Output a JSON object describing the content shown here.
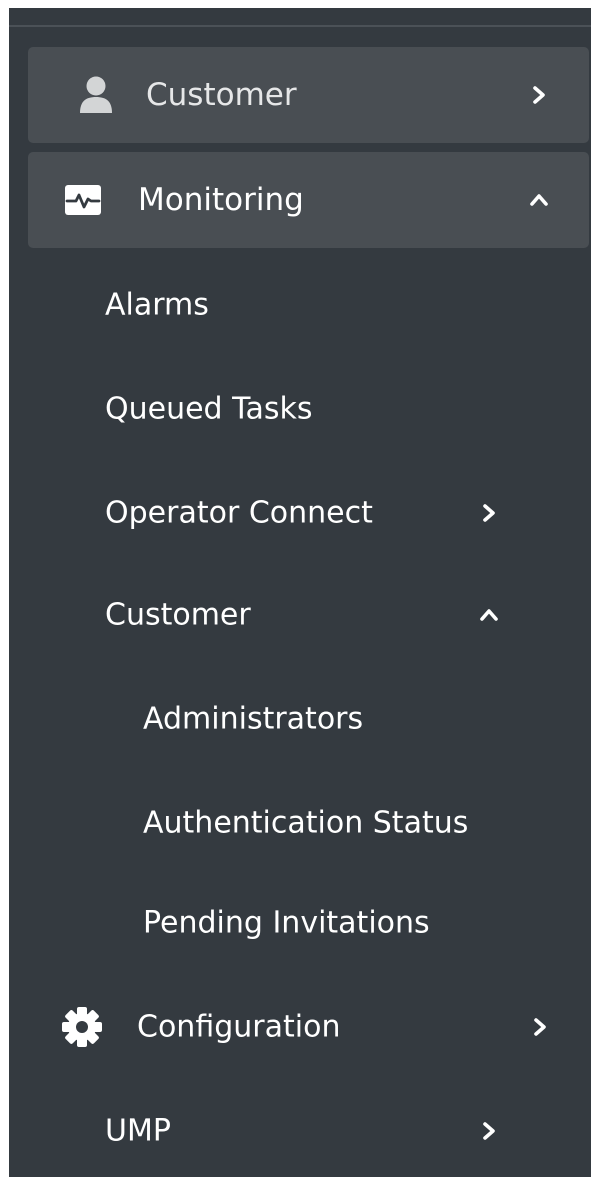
{
  "colors": {
    "sidebar_bg": "#343a40",
    "active_item_bg": "#494e53",
    "text": "#ffffff"
  },
  "nav": {
    "customer_top": {
      "label": "Customer",
      "icon": "user-icon",
      "expanded": false
    },
    "monitoring": {
      "label": "Monitoring",
      "icon": "activity-monitor-icon",
      "expanded": true
    },
    "monitoring_children": {
      "alarms": "Alarms",
      "queued_tasks": "Queued Tasks",
      "operator_connect": {
        "label": "Operator Connect",
        "expanded": false
      },
      "customer": {
        "label": "Customer",
        "expanded": true
      },
      "customer_children": {
        "administrators": "Administrators",
        "authentication_status": "Authentication Status",
        "pending_invitations": "Pending Invitations"
      }
    },
    "configuration": {
      "label": "Configuration",
      "icon": "gear-icon",
      "expanded": false
    },
    "ump": {
      "label": "UMP",
      "expanded": false
    }
  }
}
